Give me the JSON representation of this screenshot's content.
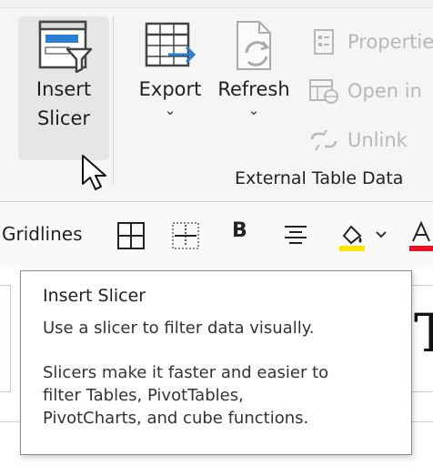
{
  "ribbon": {
    "insert_slicer": {
      "line1": "Insert",
      "line2": "Slicer"
    },
    "export": {
      "label": "Export"
    },
    "refresh": {
      "label": "Refresh"
    },
    "properties": {
      "label": "Properties",
      "icon": "properties-icon"
    },
    "open_in_browser": {
      "label": "Open in",
      "icon": "open-in-browser-icon"
    },
    "unlink": {
      "label": "Unlink",
      "icon": "unlink-icon"
    },
    "group_label": "External Table Data"
  },
  "format_row": {
    "gridlines_label": "Gridlines",
    "bold_label": "B",
    "icons": [
      "all-borders-icon",
      "inside-borders-icon",
      "bold-icon",
      "align-center-icon",
      "fill-color-icon",
      "font-color-icon"
    ],
    "fill_color": "#ffe600",
    "font_color": "#e81123"
  },
  "sheet": {
    "right_glyph": "T"
  },
  "tooltip": {
    "title": "Insert Slicer",
    "description": "Use a slicer to filter data visually.",
    "detail_lines": [
      "Slicers make it faster and easier to",
      "filter Tables, PivotTables,",
      "PivotCharts, and cube functions."
    ]
  },
  "colors": {
    "accent_blue": "#2b7cd3",
    "disabled_gray": "#b8b8b8"
  }
}
